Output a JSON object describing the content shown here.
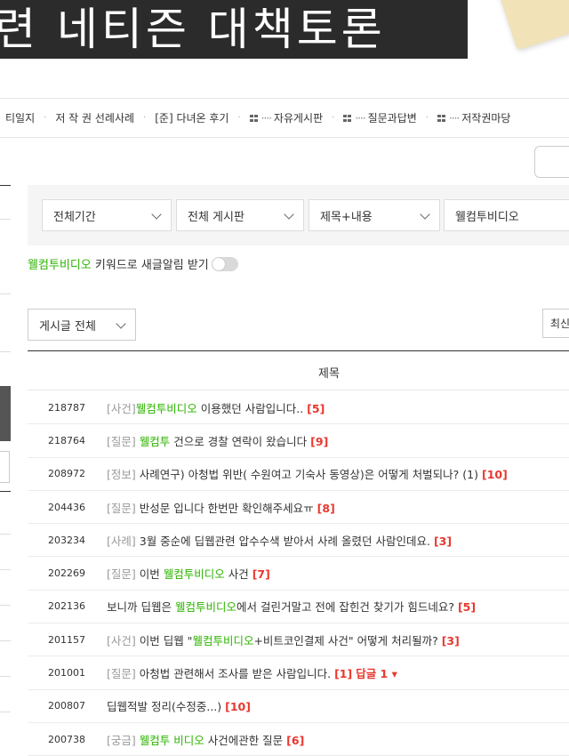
{
  "banner": {
    "text": "련 네티즌 대책토론"
  },
  "nav": {
    "items": [
      {
        "label": "티일지",
        "icon": false
      },
      {
        "label": "저 작 권 선례사례",
        "icon": false
      },
      {
        "label": "[준] 다녀온 후기",
        "icon": false
      },
      {
        "label": "자유게시판",
        "icon": true
      },
      {
        "label": "질문과답변",
        "icon": true
      },
      {
        "label": "저작권마당",
        "icon": true
      }
    ]
  },
  "search": {
    "period": "전체기간",
    "board": "전체 게시판",
    "scope": "제목+내용",
    "keyword": "웰컴투비디오"
  },
  "keyword_alert": {
    "keyword": "웰컴투비디오",
    "suffix": " 키워드로 새글알림 받기"
  },
  "list_filter": "게시글 전체",
  "sort": "최신",
  "table": {
    "title_header": "제목"
  },
  "rows": [
    {
      "num": "218787",
      "cat": "[사건]",
      "pre": "",
      "hl": "웰컴투비디오",
      "post": " 이용했던 사람입니다..",
      "count": "[5]"
    },
    {
      "num": "218764",
      "cat": "[질문]",
      "pre": "",
      "hl": "웰컴투",
      "post": " 건으로 경찰 연락이 왔습니다",
      "count": "[9]"
    },
    {
      "num": "208972",
      "cat": "[정보]",
      "pre": " 사례연구) 아청법 위반( 수원여고 기숙사 동영상)은 어떻게 처벌되나? (1)",
      "hl": "",
      "post": "",
      "count": "[10]"
    },
    {
      "num": "204436",
      "cat": "[질문]",
      "pre": " 반성문 입니다 한번만 확인해주세요ㅠ",
      "hl": "",
      "post": "",
      "count": "[8]"
    },
    {
      "num": "203234",
      "cat": "[사례]",
      "pre": " 3월 중순에 딥웹관련 압수수색 받아서 사례 올렸던 사람인데요.",
      "hl": "",
      "post": "",
      "count": "[3]"
    },
    {
      "num": "202269",
      "cat": "[질문]",
      "pre": " 이번 ",
      "hl": "웰컴투비디오",
      "post": " 사건",
      "count": "[7]"
    },
    {
      "num": "202136",
      "cat": "",
      "pre": "보니까 딥웹은 ",
      "hl": "웰컴투비디오",
      "post": "에서 걸린거말고 전에 잡힌건 찾기가 힘드네요?",
      "count": "[5]"
    },
    {
      "num": "201157",
      "cat": "[사건]",
      "pre": " 이번 딥웹 \"",
      "hl": "웰컴투비디오",
      "post": "+비트코인결제 사건\" 어떻게 처리될까?",
      "count": "[3]"
    },
    {
      "num": "201001",
      "cat": "[질문]",
      "pre": " 아청법 관련해서 조사를 받은 사람입니다.",
      "hl": "",
      "post": "",
      "count": "[1]",
      "reply": "답글 1 ▾"
    },
    {
      "num": "200807",
      "cat": "",
      "pre": "딥웹적발 정리(수정중...)",
      "hl": "",
      "post": "",
      "count": "[10]"
    },
    {
      "num": "200738",
      "cat": "[궁금]",
      "pre": " ",
      "hl": "웰컴투 비디오",
      "post": " 사건에관한 질문",
      "count": "[6]"
    }
  ]
}
